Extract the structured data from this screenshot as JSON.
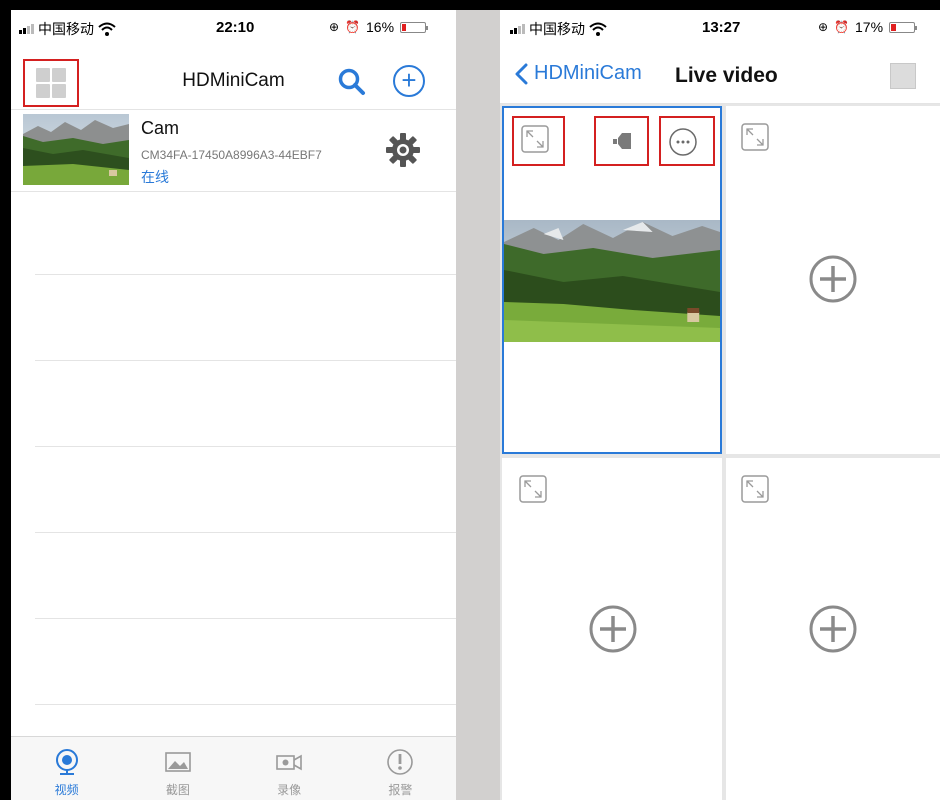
{
  "left": {
    "status": {
      "carrier": "中国移动",
      "time": "22:10",
      "battery": "16%",
      "battery_level": 0.16
    },
    "nav": {
      "title": "HDMiniCam"
    },
    "device": {
      "name": "Cam",
      "id": "CM34FA-17450A8996A3-44EBF7",
      "status": "在线"
    },
    "tabs": [
      {
        "label": "视频",
        "icon": "camera-video-icon",
        "active": true
      },
      {
        "label": "截图",
        "icon": "image-icon",
        "active": false
      },
      {
        "label": "录像",
        "icon": "video-camera-icon",
        "active": false
      },
      {
        "label": "报警",
        "icon": "alarm-icon",
        "active": false
      }
    ]
  },
  "right": {
    "status": {
      "carrier": "中国移动",
      "time": "13:27",
      "battery": "17%",
      "battery_level": 0.17
    },
    "nav": {
      "back_label": "HDMiniCam",
      "title": "Live video"
    }
  },
  "colors": {
    "accent": "#2a7ad8",
    "highlight": "#d42020"
  }
}
